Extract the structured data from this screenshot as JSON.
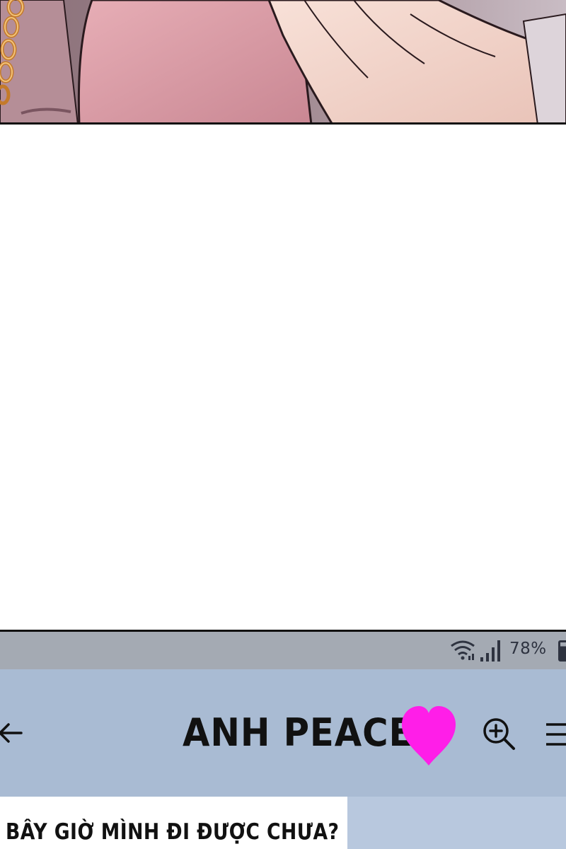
{
  "status_bar": {
    "battery_percent": "78%",
    "wifi_icon": "wifi-icon",
    "signal_icon": "signal-bars-icon",
    "battery_icon": "battery-icon"
  },
  "app_bar": {
    "title": "ANH PEACE",
    "back_icon": "arrow-left-icon",
    "heart_icon": "heart-icon",
    "zoom_icon": "zoom-in-icon",
    "menu_icon": "menu-icon"
  },
  "content": {
    "speech_text": "BÂY GIỜ MÌNH ĐI ĐƯỢC CHƯA?"
  },
  "colors": {
    "status_bar_bg": "#a4aab3",
    "app_bar_bg": "#a9bbd3",
    "heart": "#ff1ee8",
    "text": "#111111"
  }
}
